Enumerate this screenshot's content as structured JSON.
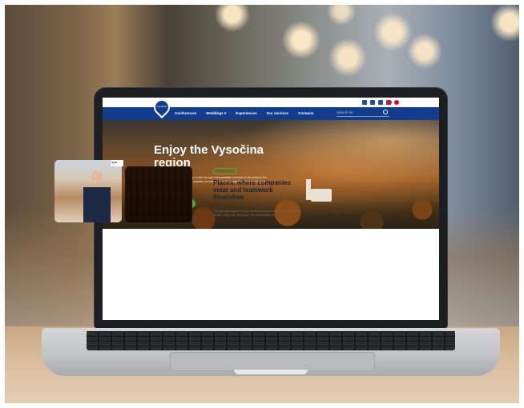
{
  "site": {
    "logo_text": "Vysočina",
    "nav": {
      "items": [
        "Conferences",
        "Weddings",
        "Experiences",
        "Our services",
        "Contacts"
      ],
      "search_placeholder": "Search for"
    },
    "hero": {
      "title": "Enjoy the Vysočina region",
      "text": "The Vysočina region invites you to five through unforgettable moments in the heart of the Czech landscape. Discover its beauties for yourself and let yourself be enchanted by its serenity.",
      "button": "Choose a place"
    },
    "section": {
      "tag": "Companies",
      "title": "Places, where companies meat and teamwork flourishes",
      "text": "The Vysočina region is known for its picturesque scenery, including vast forests, rolling hills, and lakes. This environment is..."
    },
    "sign_text": "Vys"
  },
  "colors": {
    "nav_blue": "#123d8c",
    "accent_green": "#4caf32",
    "heading_dark": "#14213d"
  }
}
